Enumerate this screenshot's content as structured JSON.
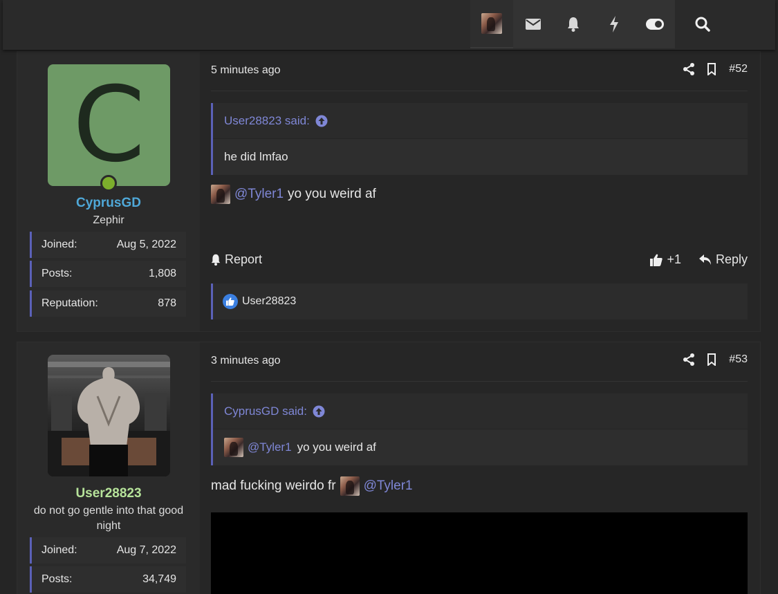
{
  "topbar": {
    "icons": [
      "user-avatar-icon",
      "envelope-icon",
      "bell-icon",
      "lightning-icon",
      "toggle-icon",
      "search-icon"
    ]
  },
  "posts": [
    {
      "user": {
        "name": "CyprusGD",
        "name_color": "#4fa8d8",
        "avatar_letter": "C",
        "avatar_bg": "#6e9a66",
        "title": "Zephir",
        "stats": [
          {
            "label": "Joined:",
            "value": "Aug 5, 2022"
          },
          {
            "label": "Posts:",
            "value": "1,808"
          },
          {
            "label": "Reputation:",
            "value": "878"
          }
        ]
      },
      "time": "5 minutes ago",
      "number": "#52",
      "quote": {
        "author": "User28823 said:",
        "text": "he did lmfao"
      },
      "body": {
        "mention": "@Tyler1",
        "text": "yo you weird af"
      },
      "report_label": "Report",
      "like_count": "+1",
      "reply_label": "Reply",
      "reactions_user": "User28823"
    },
    {
      "user": {
        "name": "User28823",
        "name_color": "#b6e39a",
        "title": "do not go gentle into that good night",
        "stats": [
          {
            "label": "Joined:",
            "value": "Aug 7, 2022"
          },
          {
            "label": "Posts:",
            "value": "34,749"
          }
        ]
      },
      "time": "3 minutes ago",
      "number": "#53",
      "quote": {
        "author": "CyprusGD said:",
        "mention": "@Tyler1",
        "text": "yo you weird af"
      },
      "body": {
        "text": "mad fucking weirdo fr",
        "mention": "@Tyler1"
      }
    }
  ]
}
